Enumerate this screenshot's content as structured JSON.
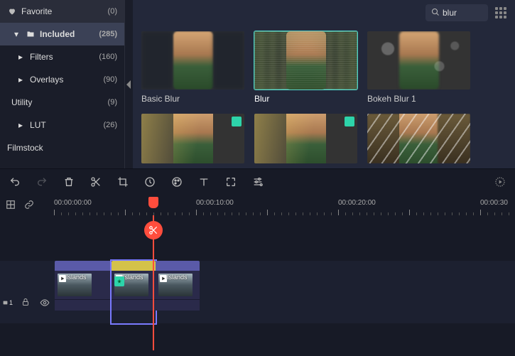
{
  "sidebar": {
    "favorite": {
      "label": "Favorite",
      "count": "(0)"
    },
    "included": {
      "label": "Included",
      "count": "(285)"
    },
    "filters": {
      "label": "Filters",
      "count": "(160)"
    },
    "overlays": {
      "label": "Overlays",
      "count": "(90)"
    },
    "utility": {
      "label": "Utility",
      "count": "(9)"
    },
    "lut": {
      "label": "LUT",
      "count": "(26)"
    },
    "filmstock": {
      "label": "Filmstock"
    }
  },
  "search": {
    "value": "blur"
  },
  "thumbs": {
    "t1": "Basic Blur",
    "t2": "Blur",
    "t3": "Bokeh Blur 1"
  },
  "timeline": {
    "t0": "00:00:00:00",
    "t1": "00:00:10:00",
    "t2": "00:00:20:00",
    "t3": "00:00:30",
    "clip_name": "Islands",
    "track_badge": "1"
  }
}
